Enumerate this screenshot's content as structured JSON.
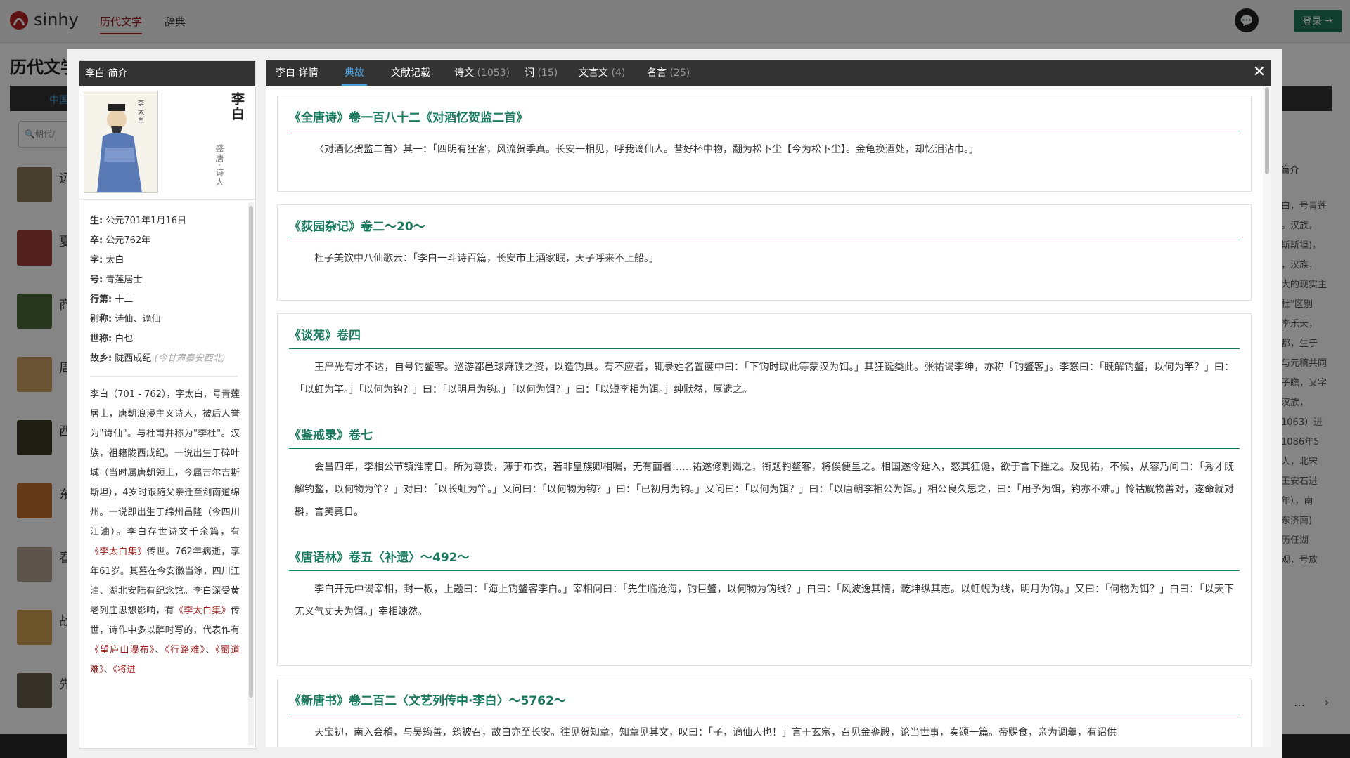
{
  "header": {
    "logo_text": "sinhy",
    "nav": [
      "历代文学",
      "辞典"
    ],
    "login_label": "登录"
  },
  "background": {
    "page_title": "历代文学",
    "tab_label": "中国",
    "search_placeholder": "朝代/",
    "list_titles": [
      "远",
      "夏",
      "商",
      "周",
      "西",
      "东",
      "春",
      "战",
      "先"
    ],
    "right_header": "简介",
    "right_snippets": [
      "白，号青莲",
      "。汉族，",
      "斯斯坦)，",
      "，汉族，",
      "大的现实主",
      "杜\"区别",
      "李乐天，",
      "都，生于",
      "与元稹共同",
      "子瞻，又字",
      "汉族，",
      "1063）进",
      "1086年5",
      "人，北宋",
      "王安石进",
      "年），南",
      "东济南)",
      "历任湖",
      "观，号放"
    ],
    "pager_left": "…",
    "pager_right": "›"
  },
  "profile": {
    "header": "李白 简介",
    "name": "李白",
    "era": "盛唐·诗人",
    "facts": [
      {
        "label": "生:",
        "value": "公元701年1月16日"
      },
      {
        "label": "卒:",
        "value": "公元762年"
      },
      {
        "label": "字:",
        "value": "太白"
      },
      {
        "label": "号:",
        "value": "青莲居士"
      },
      {
        "label": "行第:",
        "value": "十二"
      },
      {
        "label": "别称:",
        "value": "诗仙、谪仙"
      },
      {
        "label": "世称:",
        "value": "白也"
      },
      {
        "label": "故乡:",
        "value": "陇西成纪",
        "note": "(今甘肃秦安西北)"
      }
    ],
    "bio": {
      "p1": "李白（701 - 762），字太白，号青莲居士，唐朝浪漫主义诗人，被后人誉为\"诗仙\"。与杜甫并称为\"李杜\"。汉族，祖籍陇西成纪。一说出生于碎叶城（当时属唐朝领土，今属吉尔吉斯斯坦），4岁时跟随父亲迁至剑南道绵州。一说即出生于绵州昌隆（今四川江油）。李白存世诗文千余篇，有",
      "link1": "《李太白集》",
      "p2": "传世。762年病逝，享年61岁。其墓在今安徽当涂，四川江油、湖北安陆有纪念馆。李白深受黄老列庄思想影响，有",
      "link2": "《李太白集》",
      "p3": "传世，诗作中多以醉时写的，代表作有",
      "link3": "《望庐山瀑布》",
      "sep1": "、",
      "link4": "《行路难》",
      "sep2": "、",
      "link5": "《蜀道难》",
      "sep3": "、",
      "link6": "《将进"
    }
  },
  "tabs": [
    {
      "label": "李白 详情",
      "count": ""
    },
    {
      "label": "典故",
      "count": ""
    },
    {
      "label": "文献记载",
      "count": ""
    },
    {
      "label": "诗文",
      "count": "(1053)"
    },
    {
      "label": "词",
      "count": "(15)"
    },
    {
      "label": "文言文",
      "count": "(4)"
    },
    {
      "label": "名言",
      "count": "(25)"
    }
  ],
  "active_tab": "典故",
  "entries": [
    {
      "title": "《全唐诗》卷一百八十二《对酒忆贺监二首》",
      "body": "〈对酒忆贺监二首〉其一：「四明有狂客，风流贺季真。长安一相见，呼我谪仙人。昔好杯中物，翻为松下尘【今为松下尘】。金龟换酒处，却忆泪沾巾。」"
    },
    {
      "title": "《荻园杂记》卷二～20～",
      "body": "杜子美饮中八仙歌云：「李白一斗诗百篇，长安市上酒家眠，天子呼来不上船。」"
    },
    {
      "title": "《谈苑》卷四",
      "body": "王严光有才不达，自号钓鳌客。巡游都邑球麻铁之资，以造钓具。有不应者，辄录姓名置箧中曰：「下钩时取此等蒙汉为饵。」其狂诞类此。张祐谒李绅，亦称「钓鳌客」。李怒曰：「既解钓鳌，以何为竿？」曰：「以虹为竿。」「以何为钩？」曰：「以明月为钩。」「以何为饵？」曰：「以短李相为饵。」绅默然，厚遗之。"
    },
    {
      "title": "《鉴戒录》卷七",
      "body": "会昌四年，李相公节镇淮南日，所为尊贵，薄于布衣，若非皇族卿相嘱，无有面者……祐遂修刺谒之，衔题钓鳌客，将俟便呈之。相国遂令延入，怒其狂诞，欲于言下挫之。及见祐，不候，从容乃问曰：「秀才既解钓鳌，以何物为竿？」对曰：「以长虹为竿。」又问曰：「以何物为钩？」曰：「已初月为钩。」又问曰：「以何为饵？」曰：「以唐朝李相公为饵。」相公良久思之，曰：「用予为饵，钓亦不难。」怜祜觥物善对，遂命就对斟，言笑竟日。"
    },
    {
      "title": "《唐语林》卷五〈补遗〉～492～",
      "body": "李白开元中谒宰相，封一板，上题曰：「海上钓鳌客李白。」宰相问曰：「先生临沧海，钓巨鳌，以何物为钩线？」白曰：「风波逸其情，乾坤纵其志。以虹蜺为线，明月为钩。」又曰：「何物为饵？」白曰：「以天下无义气丈夫为饵。」宰相竦然。"
    },
    {
      "title": "《新唐书》卷二百二〈文艺列传中·李白〉～5762～",
      "body": "天宝初，南入会稽，与吴筠善，筠被召，故白亦至长安。往见贺知章，知章见其文，叹曰：「子，谪仙人也！」言于玄宗，召见金銮殿，论当世事，奏颂一篇。帝赐食，亲为调羹，有诏供"
    }
  ],
  "colors": {
    "accent_green": "#1a7a5c",
    "accent_red": "#9b1c1c",
    "tab_active_blue": "#4aa3df",
    "dark_bar": "#333333"
  }
}
